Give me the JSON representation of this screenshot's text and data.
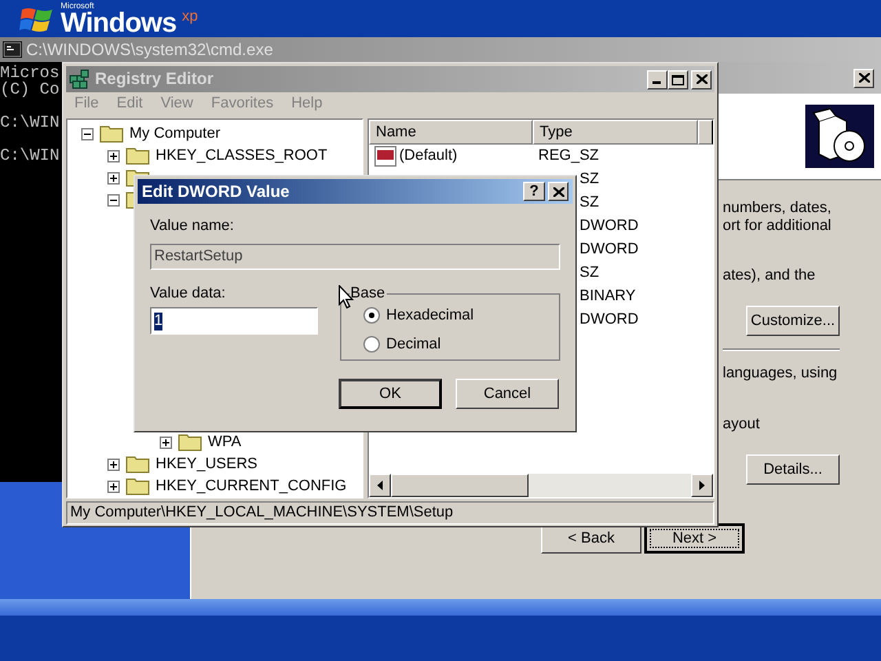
{
  "desktop": {
    "logo": {
      "maker": "Microsoft",
      "product": "Windows",
      "edition": "xp"
    }
  },
  "console": {
    "title": "C:\\WINDOWS\\system32\\cmd.exe",
    "blocks": [
      [
        "Micros",
        "(C) Co"
      ],
      [
        "C:\\WIN"
      ],
      [
        "C:\\WIN"
      ]
    ]
  },
  "wizard": {
    "upper_lines": [
      "numbers, dates,",
      "ort for additional"
    ],
    "middle_line": "ates), and the",
    "customize": {
      "label": "Customize..."
    },
    "lower_lines": [
      "languages, using",
      "ayout"
    ],
    "details": {
      "label": "Details..."
    },
    "nav_buttons": [
      {
        "label": "< Back",
        "default": false
      },
      {
        "label": "Next >",
        "default": true
      }
    ]
  },
  "registry": {
    "title": "Registry Editor",
    "menu": [
      "File",
      "Edit",
      "View",
      "Favorites",
      "Help"
    ],
    "tree": {
      "label": "My Computer",
      "expanded": true,
      "children": [
        {
          "label": "HKEY_CLASSES_ROOT",
          "expanded": false
        },
        {
          "expanded": false
        },
        {
          "expanded": true
        }
      ]
    },
    "tree_lower_nested": [
      {
        "label": "WPA",
        "expanded": false
      }
    ],
    "tree_lower": [
      {
        "label": "HKEY_USERS",
        "expanded": false
      },
      {
        "label": "HKEY_CURRENT_CONFIG",
        "expanded": false
      }
    ],
    "columns": [
      "Name",
      "Type"
    ],
    "rows": [
      {
        "name": "(Default)",
        "type": "REG_SZ"
      },
      {
        "type": "SZ"
      },
      {
        "type": "SZ"
      },
      {
        "type": "DWORD"
      },
      {
        "type": "DWORD"
      },
      {
        "type": "SZ"
      },
      {
        "type": "BINARY"
      },
      {
        "type": "DWORD"
      }
    ],
    "status_bar": "My Computer\\HKEY_LOCAL_MACHINE\\SYSTEM\\Setup"
  },
  "dialog": {
    "title": "Edit DWORD Value",
    "help": "?",
    "value_name_label": "Value name:",
    "value_name": "RestartSetup",
    "value_data_label": "Value data:",
    "value_data": "1",
    "value_data_selected": true,
    "base_label": "Base",
    "bases": [
      {
        "label": "Hexadecimal",
        "selected": true
      },
      {
        "label": "Decimal",
        "selected": false
      }
    ],
    "buttons": [
      {
        "label": "OK",
        "default": true
      },
      {
        "label": "Cancel",
        "default": false
      }
    ]
  }
}
